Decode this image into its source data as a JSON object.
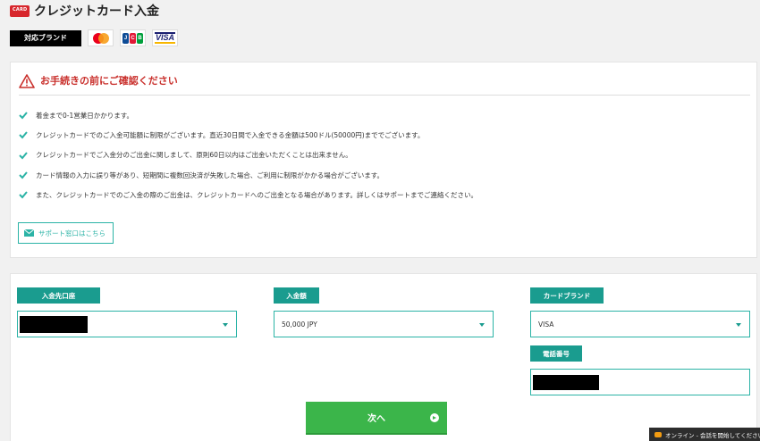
{
  "header": {
    "card_icon_text": "CARD",
    "title": "クレジットカード入金"
  },
  "brands": {
    "label": "対応ブランド",
    "logos": [
      "mastercard",
      "JCB",
      "VISA"
    ],
    "jcb_letters": [
      "J",
      "C",
      "B"
    ],
    "visa_text": "VISA"
  },
  "notice": {
    "title": "お手続きの前にご確認ください",
    "items": [
      "着金まで0-1営業日かかります。",
      "クレジットカードでのご入金可能額に制限がございます。直近30日間で入金できる金額は500ドル(50000円)まででございます。",
      "クレジットカードでご入金分のご出金に関しまして、原則60日以内はご出金いただくことは出来ません。",
      "カード情報の入力に誤り等があり、短期間に複数回決済が失敗した場合、ご利用に制限がかかる場合がございます。",
      "また、クレジットカードでのご入金の際のご出金は、クレジットカードへのご出金となる場合があります。詳しくはサポートまでご連絡ください。"
    ],
    "support_button": "サポート窓口はこちら"
  },
  "form": {
    "account_label": "入金先口座",
    "account_value": "",
    "amount_label": "入金額",
    "amount_value": "50,000 JPY",
    "brand_label": "カードブランド",
    "brand_value": "VISA",
    "phone_label": "電話番号",
    "phone_value": ""
  },
  "next_button": "次へ",
  "chat": "オンライン - 会話を開始してください",
  "colors": {
    "accent": "#2bb3a6",
    "label_bg": "#1a9c8f",
    "warning": "#c9302c",
    "primary_button": "#3bb54a",
    "card_icon": "#d7262c"
  }
}
